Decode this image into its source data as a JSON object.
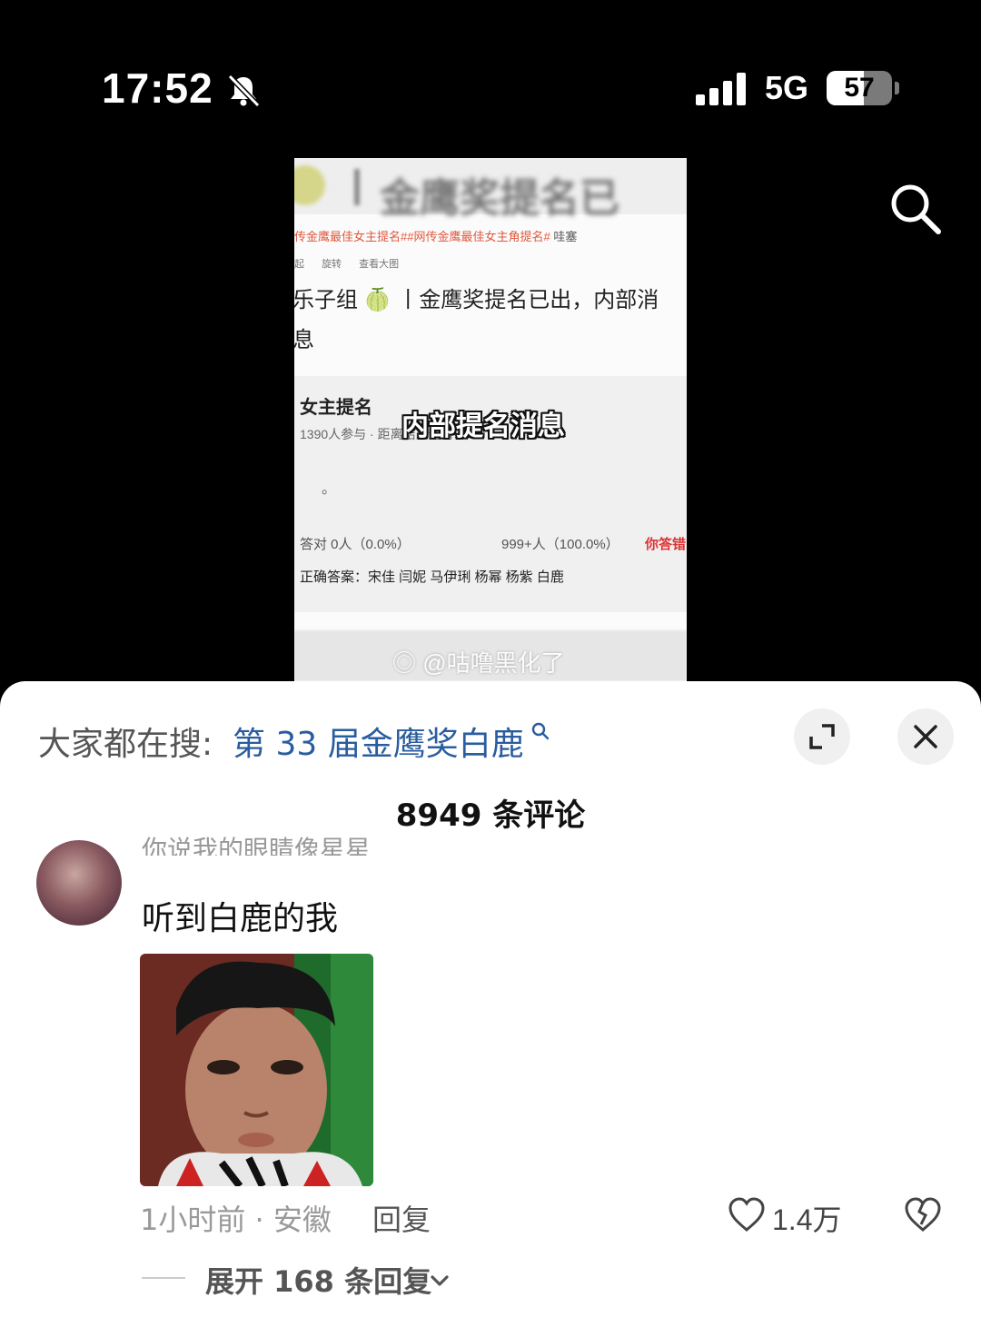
{
  "status": {
    "time": "17:52",
    "network": "5G",
    "battery": "57",
    "battery_level": 0.57
  },
  "video": {
    "blurred_title": "金鹰奖提名已",
    "tags": "传金鹰最佳女主提名##网传金鹰最佳女主角提名#",
    "tags_suffix": "哇塞",
    "tool_items": [
      "起",
      "旋转",
      "查看大图"
    ],
    "heading_line1": "乐子组 🍈 丨金鹰奖提名已出，内部消",
    "heading_line2": "息",
    "card_title": "女主提名",
    "card_meta": "1390人参与 · 距离结束还有",
    "overlay_caption": "内部提名消息",
    "period": "。",
    "correct_stats": "答对  0人（0.0%）",
    "wrong_stats": "999+人（100.0%）",
    "wrong_label": "你答错",
    "answer": "正确答案：宋佳 闫妮 马伊琍 杨幂 杨紫 白鹿",
    "watermark": "@咕噜黑化了"
  },
  "sheet": {
    "search_label": "大家都在搜:",
    "search_query": "第 33 届金鹰奖白鹿",
    "comment_count": "8949 条评论"
  },
  "comment": {
    "username": "你说我的眼睛像星星",
    "text": "听到白鹿的我",
    "meta": "1小时前 · 安徽",
    "reply_label": "回复",
    "like_count": "1.4万",
    "expand_label": "展开 168 条回复"
  },
  "icons": {
    "bell": "bell-slash-icon",
    "signal": "signal-icon",
    "search": "search-icon",
    "expand": "expand-icon",
    "close": "close-icon",
    "like": "heart-icon",
    "dislike": "broken-heart-icon",
    "chevron": "chevron-down-icon"
  },
  "colors": {
    "link": "#2a5d9f",
    "tag": "#e0583c",
    "wrong": "#dd3333"
  }
}
